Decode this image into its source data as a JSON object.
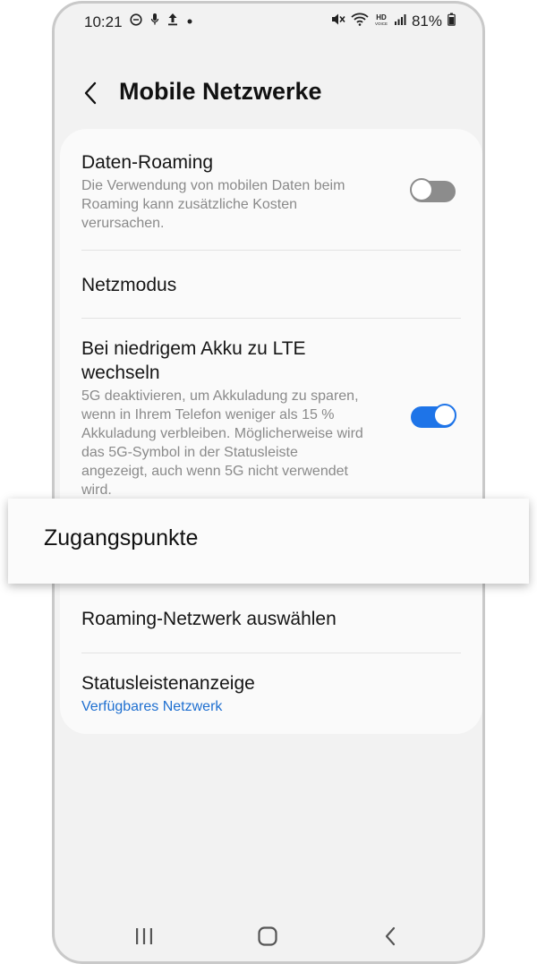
{
  "status_bar": {
    "time": "10:21",
    "icons_left": [
      "do-not-disturb-icon",
      "mic-icon",
      "upload-icon",
      "dot-icon"
    ],
    "icons_right": [
      "mute-icon",
      "wifi-icon",
      "hd-voice-icon",
      "signal-icon"
    ],
    "battery": "81%"
  },
  "app_bar": {
    "title": "Mobile Netzwerke"
  },
  "settings": {
    "data_roaming": {
      "title": "Daten-Roaming",
      "description": "Die Verwendung von mobilen Daten beim Roaming kann zusätzliche Kosten verursachen.",
      "enabled": false
    },
    "network_mode": {
      "title": "Netzmodus"
    },
    "lte_low_battery": {
      "title": "Bei niedrigem Akku zu LTE wechseln",
      "description": "5G deaktivieren, um Akkuladung zu sparen, wenn in Ihrem Telefon weniger als 15 % Akkuladung verbleiben. Möglicherweise wird das 5G-Symbol in der Statusleiste angezeigt, auch wenn 5G nicht verwendet wird.",
      "enabled": true
    },
    "roaming_network": {
      "title": "Roaming-Netzwerk auswählen"
    },
    "status_bar_display": {
      "title": "Statusleistenanzeige",
      "value": "Verfügbares Netzwerk"
    }
  },
  "highlight": {
    "label": "Zugangspunkte"
  },
  "colors": {
    "accent": "#1e74e8",
    "link": "#1e6fd0",
    "background": "#f2f2f2",
    "card": "#fafafa"
  }
}
